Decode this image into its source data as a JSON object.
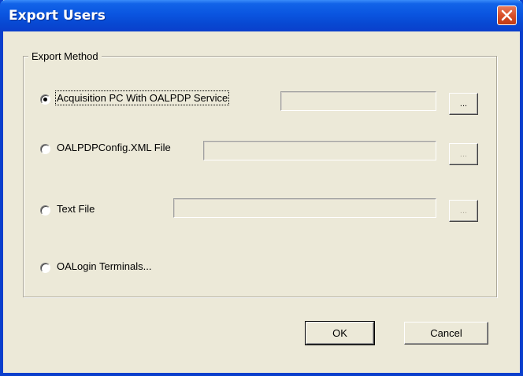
{
  "dialog": {
    "title": "Export Users",
    "close_icon": "close-icon",
    "accent_color": "#0A3FCC",
    "close_color": "#D9502A"
  },
  "group": {
    "legend": "Export Method"
  },
  "options": [
    {
      "label": "Acquisition PC With OALPDP Service",
      "selected": true,
      "field_value": "",
      "browse_label": "...",
      "browse_enabled": true
    },
    {
      "label": "OALPDPConfig.XML File",
      "selected": false,
      "field_value": "",
      "browse_label": "...",
      "browse_enabled": false
    },
    {
      "label": "Text File",
      "selected": false,
      "field_value": "",
      "browse_label": "...",
      "browse_enabled": false
    },
    {
      "label": "OALogin Terminals...",
      "selected": false
    }
  ],
  "buttons": {
    "ok": "OK",
    "cancel": "Cancel"
  }
}
